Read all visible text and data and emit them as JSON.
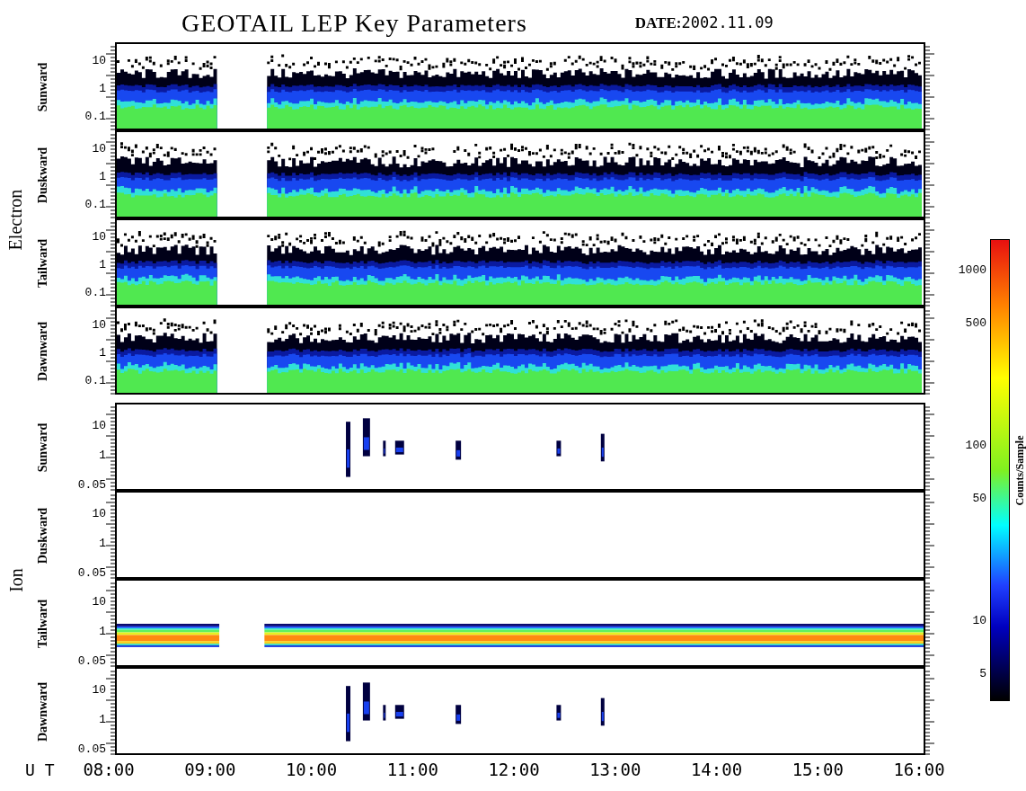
{
  "title": "GEOTAIL LEP Key Parameters",
  "date": {
    "label": "DATE:",
    "value": "2002.11.09"
  },
  "groups": [
    {
      "name": "Electron",
      "panels": [
        {
          "label": "Sunward",
          "kind": "dense",
          "y_ticks": [
            "10",
            "1",
            "0.1"
          ]
        },
        {
          "label": "Duskward",
          "kind": "dense",
          "y_ticks": [
            "10",
            "1",
            "0.1"
          ]
        },
        {
          "label": "Tailward",
          "kind": "dense",
          "y_ticks": [
            "10",
            "1",
            "0.1"
          ]
        },
        {
          "label": "Dawnward",
          "kind": "dense",
          "y_ticks": [
            "10",
            "1",
            "0.1"
          ]
        }
      ]
    },
    {
      "name": "Ion",
      "panels": [
        {
          "label": "Sunward",
          "kind": "sparse",
          "y_ticks": [
            "10",
            "1",
            "0.05"
          ]
        },
        {
          "label": "Duskward",
          "kind": "empty",
          "y_ticks": [
            "10",
            "1",
            "0.05"
          ]
        },
        {
          "label": "Tailward",
          "kind": "band",
          "y_ticks": [
            "10",
            "1",
            "0.05"
          ]
        },
        {
          "label": "Dawnward",
          "kind": "sparse",
          "y_ticks": [
            "10",
            "1",
            "0.05"
          ]
        }
      ]
    }
  ],
  "time_axis": {
    "label": "U T",
    "ticks": [
      "08:00",
      "09:00",
      "10:00",
      "11:00",
      "12:00",
      "13:00",
      "14:00",
      "15:00",
      "16:00"
    ]
  },
  "colorbar": {
    "title": "Counts/Sample",
    "ticks": [
      "1000",
      "500",
      "100",
      "50",
      "10",
      "5"
    ]
  }
}
